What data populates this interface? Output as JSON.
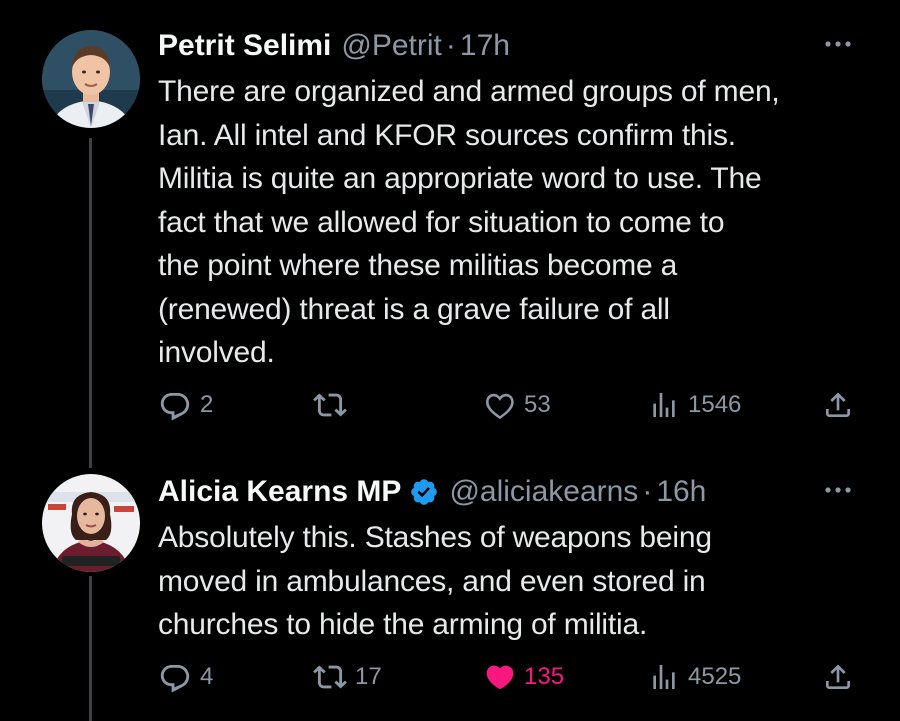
{
  "tweets": [
    {
      "author_name": "Petrit Selimi",
      "handle": "@Petrit",
      "separator": "·",
      "time": "17h",
      "verified": false,
      "body_lines": [
        "There are organized and armed groups of men,",
        "Ian. All intel and KFOR sources confirm this.",
        "Militia is quite an appropriate word to use. The",
        "fact that we allowed for situation to come to",
        "the point where these militias become a",
        "(renewed) threat is a grave failure of all",
        "involved."
      ],
      "replies": "2",
      "retweets": "",
      "likes": "53",
      "views": "1546",
      "liked": false
    },
    {
      "author_name": "Alicia Kearns MP",
      "handle": "@aliciakearns",
      "separator": "·",
      "time": "16h",
      "verified": true,
      "body_lines": [
        "Absolutely this. Stashes of weapons being",
        "moved in ambulances, and even stored in",
        "churches to hide the arming of militia."
      ],
      "replies": "4",
      "retweets": "17",
      "likes": "135",
      "views": "4525",
      "liked": true
    }
  ],
  "icons": {
    "reply": "reply-icon",
    "retweet": "retweet-icon",
    "like": "heart-icon",
    "views": "views-icon",
    "share": "share-icon",
    "more": "more-icon",
    "verified": "verified-badge-icon"
  },
  "colors": {
    "background": "#000000",
    "text": "#e7e9ea",
    "secondary": "#8b98a5",
    "like_active": "#f91880",
    "verified": "#1d9bf0",
    "thread_line": "#3e4144"
  }
}
